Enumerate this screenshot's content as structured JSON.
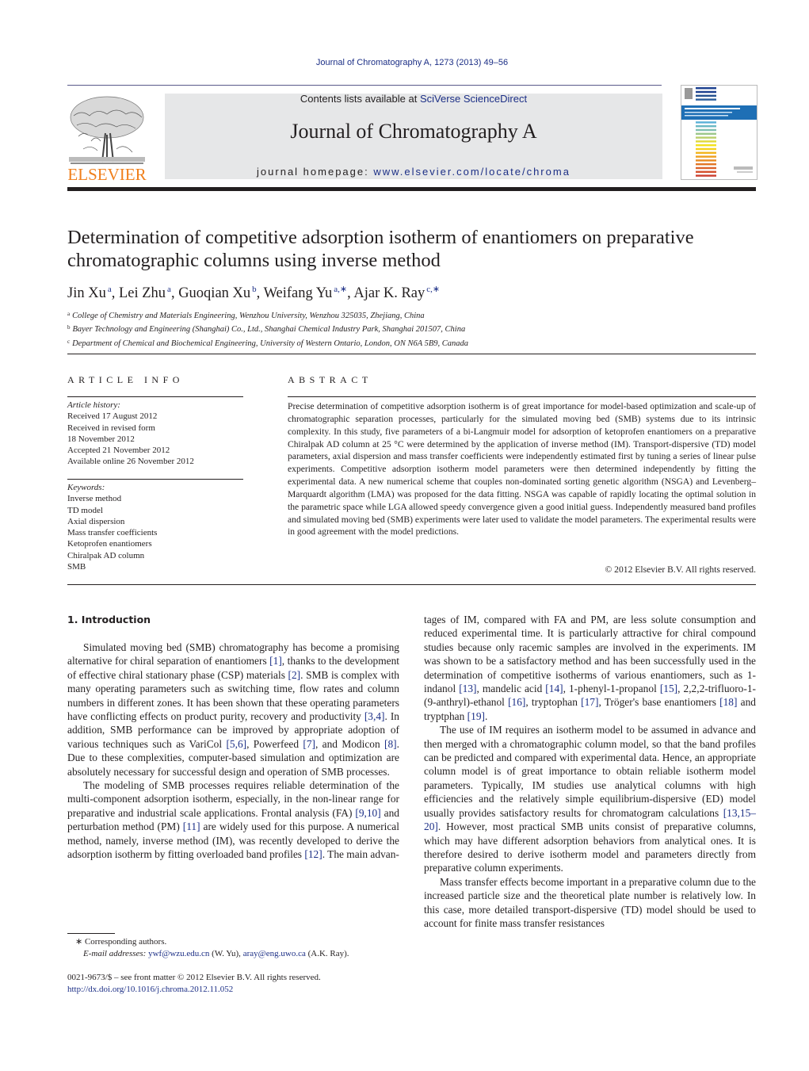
{
  "header": {
    "running_head": "Journal of Chromatography A, 1273 (2013) 49–56",
    "contents_prefix": "Contents lists available at ",
    "contents_link": "SciVerse ScienceDirect",
    "journal_title": "Journal of Chromatography A",
    "homepage_prefix": "journal homepage: ",
    "homepage_link": "www.elsevier.com/locate/chroma",
    "publisher_logo_text": "ELSEVIER",
    "colors": {
      "link": "#1c2f86",
      "elsevier_orange": "#f07f1b",
      "banner_gray": "#e6e7e8"
    }
  },
  "article": {
    "title": "Determination of competitive adsorption isotherm of enantiomers on preparative chromatographic columns using inverse method",
    "authors": [
      {
        "name": "Jin Xu",
        "sup": "a"
      },
      {
        "name": "Lei Zhu",
        "sup": "a"
      },
      {
        "name": "Guoqian Xu",
        "sup": "b"
      },
      {
        "name": "Weifang Yu",
        "sup": "a,∗"
      },
      {
        "name": "Ajar K. Ray",
        "sup": "c,∗"
      }
    ],
    "affiliations": [
      {
        "key": "a",
        "text": "College of Chemistry and Materials Engineering, Wenzhou University, Wenzhou 325035, Zhejiang, China"
      },
      {
        "key": "b",
        "text": "Bayer Technology and Engineering (Shanghai) Co., Ltd., Shanghai Chemical Industry Park, Shanghai 201507, China"
      },
      {
        "key": "c",
        "text": "Department of Chemical and Biochemical Engineering, University of Western Ontario, London, ON N6A 5B9, Canada"
      }
    ]
  },
  "article_info": {
    "heading": "ARTICLE INFO",
    "history_label": "Article history:",
    "history": [
      "Received 17 August 2012",
      "Received in revised form",
      "18 November 2012",
      "Accepted 21 November 2012",
      "Available online 26 November 2012"
    ],
    "keywords_label": "Keywords:",
    "keywords": [
      "Inverse method",
      "TD model",
      "Axial dispersion",
      "Mass transfer coefficients",
      "Ketoprofen enantiomers",
      "Chiralpak AD column",
      "SMB"
    ]
  },
  "abstract": {
    "heading": "ABSTRACT",
    "text": "Precise determination of competitive adsorption isotherm is of great importance for model-based optimization and scale-up of chromatographic separation processes, particularly for the simulated moving bed (SMB) systems due to its intrinsic complexity. In this study, five parameters of a bi-Langmuir model for adsorption of ketoprofen enantiomers on a preparative Chiralpak AD column at 25 °C were determined by the application of inverse method (IM). Transport-dispersive (TD) model parameters, axial dispersion and mass transfer coefficients were independently estimated first by tuning a series of linear pulse experiments. Competitive adsorption isotherm model parameters were then determined independently by fitting the experimental data. A new numerical scheme that couples non-dominated sorting genetic algorithm (NSGA) and Levenberg–Marquardt algorithm (LMA) was proposed for the data fitting. NSGA was capable of rapidly locating the optimal solution in the parametric space while LGA allowed speedy convergence given a good initial guess. Independently measured band profiles and simulated moving bed (SMB) experiments were later used to validate the model parameters. The experimental results were in good agreement with the model predictions.",
    "copyright": "© 2012 Elsevier B.V. All rights reserved."
  },
  "body": {
    "section_heading": "1.  Introduction",
    "left_paragraphs": [
      [
        {
          "t": "Simulated moving bed (SMB) chromatography has become a promising alternative for chiral separation of enantiomers "
        },
        {
          "r": "[1]"
        },
        {
          "t": ", thanks to the development of effective chiral stationary phase (CSP) materials "
        },
        {
          "r": "[2]"
        },
        {
          "t": ". SMB is complex with many operating parameters such as switching time, flow rates and column numbers in different zones. It has been shown that these operating parameters have conflicting effects on product purity, recovery and productivity "
        },
        {
          "r": "[3,4]"
        },
        {
          "t": ". In addition, SMB performance can be improved by appropriate adoption of various techniques such as VariCol "
        },
        {
          "r": "[5,6]"
        },
        {
          "t": ", Powerfeed "
        },
        {
          "r": "[7]"
        },
        {
          "t": ", and Modicon "
        },
        {
          "r": "[8]"
        },
        {
          "t": ". Due to these complexities, computer-based simulation and optimization are absolutely necessary for successful design and operation of SMB processes."
        }
      ],
      [
        {
          "t": "The modeling of SMB processes requires reliable determination of the multi-component adsorption isotherm, especially, in the non-linear range for preparative and industrial scale applications. Frontal analysis (FA) "
        },
        {
          "r": "[9,10]"
        },
        {
          "t": " and perturbation method (PM) "
        },
        {
          "r": "[11]"
        },
        {
          "t": " are widely used for this purpose. A numerical method, namely, inverse method (IM), was recently developed to derive the adsorption isotherm by fitting overloaded band profiles "
        },
        {
          "r": "[12]"
        },
        {
          "t": ". The main advan-"
        }
      ]
    ],
    "right_paragraphs": [
      [
        {
          "t": "tages of IM, compared with FA and PM, are less solute consumption and reduced experimental time. It is particularly attractive for chiral compound studies because only racemic samples are involved in the experiments. IM was shown to be a satisfactory method and has been successfully used in the determination of competitive isotherms of various enantiomers, such as 1-indanol "
        },
        {
          "r": "[13]"
        },
        {
          "t": ", mandelic acid "
        },
        {
          "r": "[14]"
        },
        {
          "t": ", 1-phenyl-1-propanol "
        },
        {
          "r": "[15]"
        },
        {
          "t": ", 2,2,2-trifluoro-1-(9-anthryl)-ethanol "
        },
        {
          "r": "[16]"
        },
        {
          "t": ", tryptophan "
        },
        {
          "r": "[17]"
        },
        {
          "t": ", Tröger's base enantiomers "
        },
        {
          "r": "[18]"
        },
        {
          "t": " and tryptphan "
        },
        {
          "r": "[19]"
        },
        {
          "t": "."
        }
      ],
      [
        {
          "t": "The use of IM requires an isotherm model to be assumed in advance and then merged with a chromatographic column model, so that the band profiles can be predicted and compared with experimental data. Hence, an appropriate column model is of great importance to obtain reliable isotherm model parameters. Typically, IM studies use analytical columns with high efficiencies and the relatively simple equilibrium-dispersive (ED) model usually provides satisfactory results for chromatogram calculations "
        },
        {
          "r": "[13,15–20]"
        },
        {
          "t": ". However, most practical SMB units consist of preparative columns, which may have different adsorption behaviors from analytical ones. It is therefore desired to derive isotherm model and parameters directly from preparative column experiments."
        }
      ],
      [
        {
          "t": "Mass transfer effects become important in a preparative column due to the increased particle size and the theoretical plate number is relatively low. In this case, more detailed transport-dispersive (TD) model should be used to account for finite mass transfer resistances"
        }
      ]
    ]
  },
  "footnotes": {
    "corresponding": "∗  Corresponding authors.",
    "email_label": "E-mail addresses:",
    "emails": [
      {
        "address": "ywf@wzu.edu.cn",
        "who": " (W. Yu), "
      },
      {
        "address": "aray@eng.uwo.ca",
        "who": " (A.K. Ray)."
      }
    ],
    "issn": "0021-9673/$ – see front matter © 2012 Elsevier B.V. All rights reserved.",
    "doi": "http://dx.doi.org/10.1016/j.chroma.2012.11.052"
  }
}
